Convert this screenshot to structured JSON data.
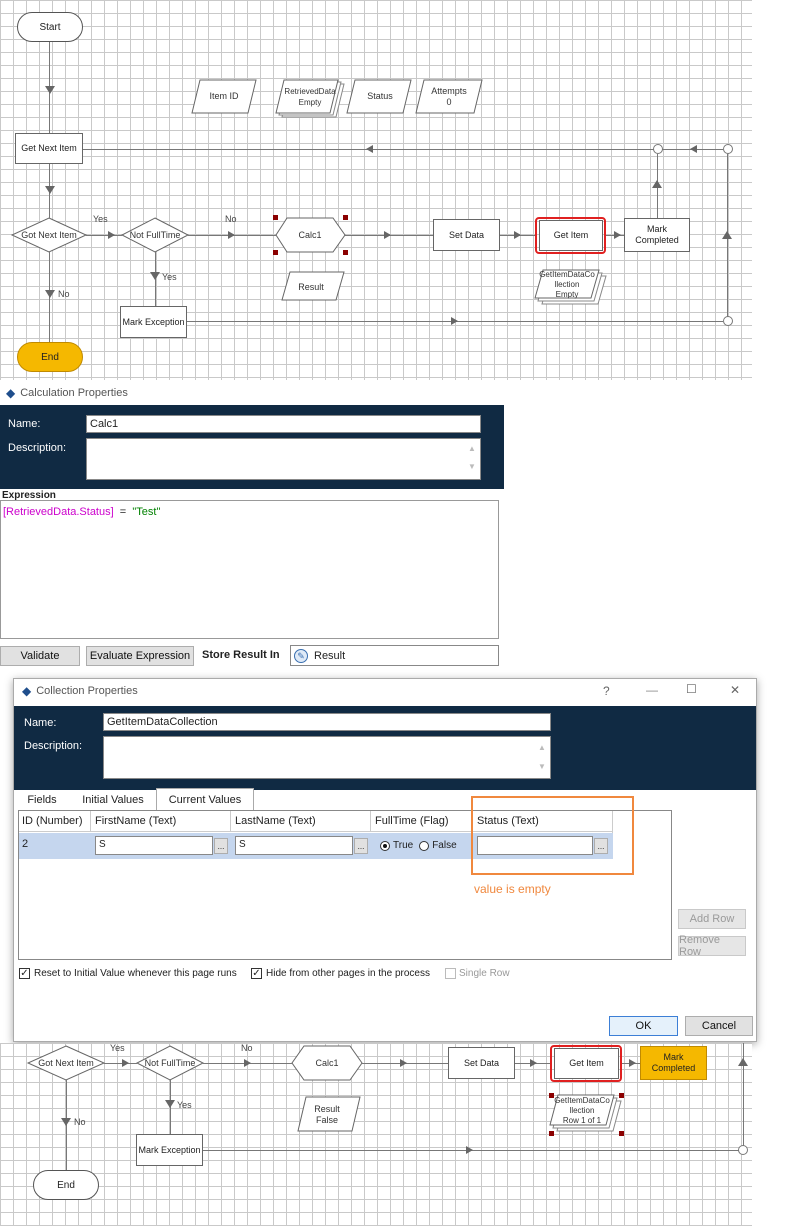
{
  "top_flow": {
    "start": "Start",
    "item_id": "Item ID",
    "retrieved_data": [
      "RetrievedData",
      "Empty"
    ],
    "status": "Status",
    "attempts": [
      "Attempts",
      "0"
    ],
    "get_next_item": "Get Next Item",
    "got_next_item": "Got Next Item",
    "yes1": "Yes",
    "not_fulltime": "Not FullTime",
    "no1": "No",
    "calc1": "Calc1",
    "set_data": "Set Data",
    "get_item": "Get Item",
    "mark_completed": [
      "Mark",
      "Completed"
    ],
    "yes2": "Yes",
    "result": "Result",
    "collection": [
      "GetItemDataCo",
      "llection",
      "Empty"
    ],
    "no2": "No",
    "mark_exception": "Mark Exception",
    "end": "End"
  },
  "calc_dialog": {
    "title": "Calculation Properties",
    "name_label": "Name:",
    "name_value": "Calc1",
    "description_label": "Description:",
    "expression_label": "Expression",
    "expr_field": "[RetrievedData.Status]",
    "expr_op": "=",
    "expr_value": "\"Test\"",
    "validate_btn": "Validate",
    "evaluate_btn": "Evaluate Expression",
    "store_label": "Store Result In",
    "store_value": "Result"
  },
  "collection_dialog": {
    "title": "Collection Properties",
    "help": "?",
    "minimize": "—",
    "maximize": "☐",
    "close": "✕",
    "name_label": "Name:",
    "name_value": "GetItemDataCollection",
    "description_label": "Description:",
    "tabs": [
      "Fields",
      "Initial Values",
      "Current Values"
    ],
    "columns": [
      "ID (Number)",
      "FirstName (Text)",
      "LastName (Text)",
      "FullTime (Flag)",
      "Status (Text)"
    ],
    "row": {
      "id": "2",
      "first": "S",
      "last": "S",
      "true_label": "True",
      "false_label": "False",
      "status": ""
    },
    "annotation": "value is empty",
    "add_row": "Add Row",
    "remove_row": "Remove Row",
    "reset_label": "Reset to Initial Value whenever this page runs",
    "hide_label": "Hide from other pages in the process",
    "single_row_label": "Single Row",
    "ok": "OK",
    "cancel": "Cancel",
    "ellipsis": "..."
  },
  "bottom_flow": {
    "got_next_item": "Got Next Item",
    "yes1": "Yes",
    "not_fulltime": "Not FullTime",
    "no1": "No",
    "calc1": "Calc1",
    "set_data": "Set Data",
    "get_item": "Get Item",
    "mark_completed": [
      "Mark",
      "Completed"
    ],
    "yes2": "Yes",
    "result": [
      "Result",
      "False"
    ],
    "collection": [
      "GetItemDataCo",
      "llection",
      "Row 1 of 1"
    ],
    "no2": "No",
    "mark_exception": "Mark Exception",
    "end": "End"
  },
  "colors": {
    "navy": "#102a43",
    "end_yellow": "#f5b800",
    "highlight_red": "#e02020",
    "annotation_orange": "#f0883e",
    "expr_field": "#cc00cc",
    "expr_value": "#008000"
  }
}
